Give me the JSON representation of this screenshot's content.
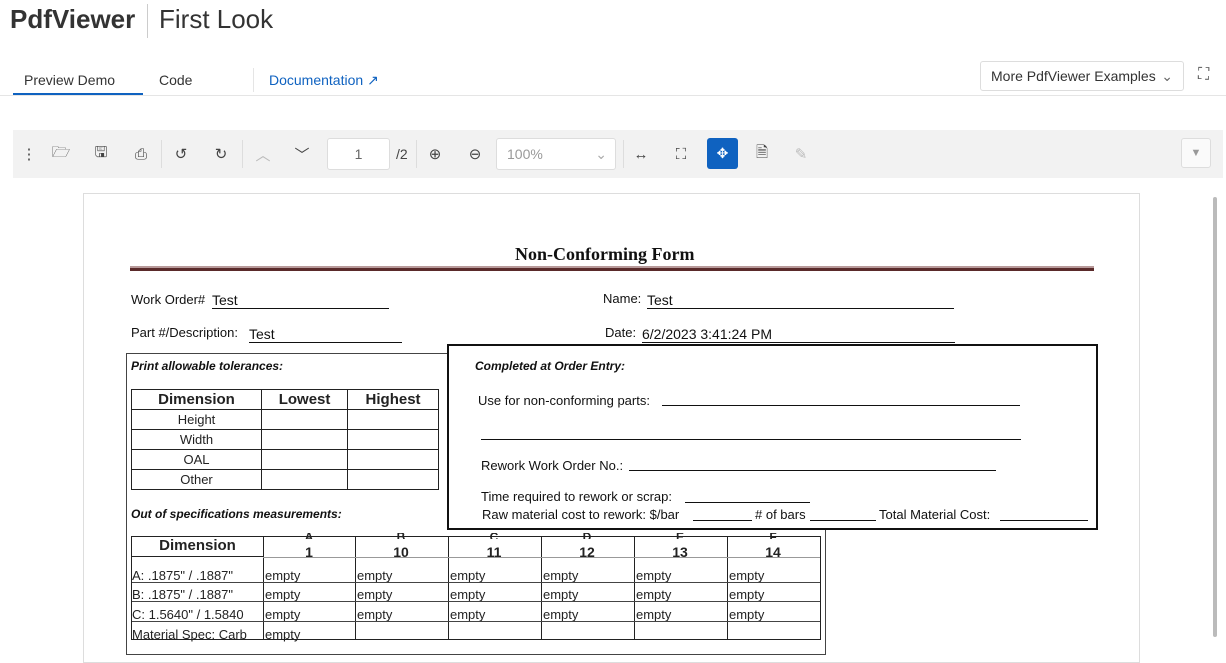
{
  "header": {
    "title": "PdfViewer",
    "subtitle": "First Look"
  },
  "tabs": [
    {
      "label": "Preview Demo",
      "active": true
    },
    {
      "label": "Code"
    }
  ],
  "documentation_link": "Documentation",
  "examples_dropdown": "More PdfViewer Examples",
  "toolbar": {
    "current_page": "1",
    "total_pages": "/2",
    "zoom": "100%",
    "accent": "#0f62c0"
  },
  "form": {
    "title": "Non-Conforming Form",
    "work_order_label": "Work Order#",
    "work_order_value": "Test",
    "name_label": "Name:",
    "name_value": "Test",
    "part_label": "Part #/Description:",
    "part_value": "Test",
    "date_label": "Date:",
    "date_value": "6/2/2023 3:41:24 PM",
    "tolerances_heading": "Print allowable tolerances:",
    "tol_headers": [
      "Dimension",
      "Lowest",
      "Highest"
    ],
    "tol_rows": [
      "Height",
      "Width",
      "OAL",
      "Other"
    ],
    "order_entry_heading": "Completed at Order Entry:",
    "non_conforming_label": "Use for non-conforming parts:",
    "rework_label": "Rework Work Order No.:",
    "time_label": "Time required to rework or scrap:",
    "raw_cost_label": "Raw material cost to rework: $/bar",
    "bars_label": "# of bars",
    "total_cost_label": "Total Material Cost:",
    "out_spec_heading": "Out of specifications measurements:",
    "meas_header": "Dimension",
    "meas_cols": [
      {
        "letter": "A",
        "num": "1"
      },
      {
        "letter": "B",
        "num": "10"
      },
      {
        "letter": "C",
        "num": "11"
      },
      {
        "letter": "D",
        "num": "12"
      },
      {
        "letter": "E",
        "num": "13"
      },
      {
        "letter": "F",
        "num": "14"
      }
    ],
    "meas_rows": [
      {
        "label": "A: .1875\" / .1887\"",
        "cells": [
          "empty",
          "empty",
          "empty",
          "empty",
          "empty",
          "empty"
        ]
      },
      {
        "label": "B: .1875\" / .1887\"",
        "cells": [
          "empty",
          "empty",
          "empty",
          "empty",
          "empty",
          "empty"
        ]
      },
      {
        "label": "C: 1.5640\" / 1.5840",
        "cells": [
          "empty",
          "empty",
          "empty",
          "empty",
          "empty",
          "empty"
        ]
      },
      {
        "label": "Material Spec: Carb",
        "cells": [
          "empty",
          "",
          "",
          "",
          "",
          ""
        ]
      }
    ]
  }
}
